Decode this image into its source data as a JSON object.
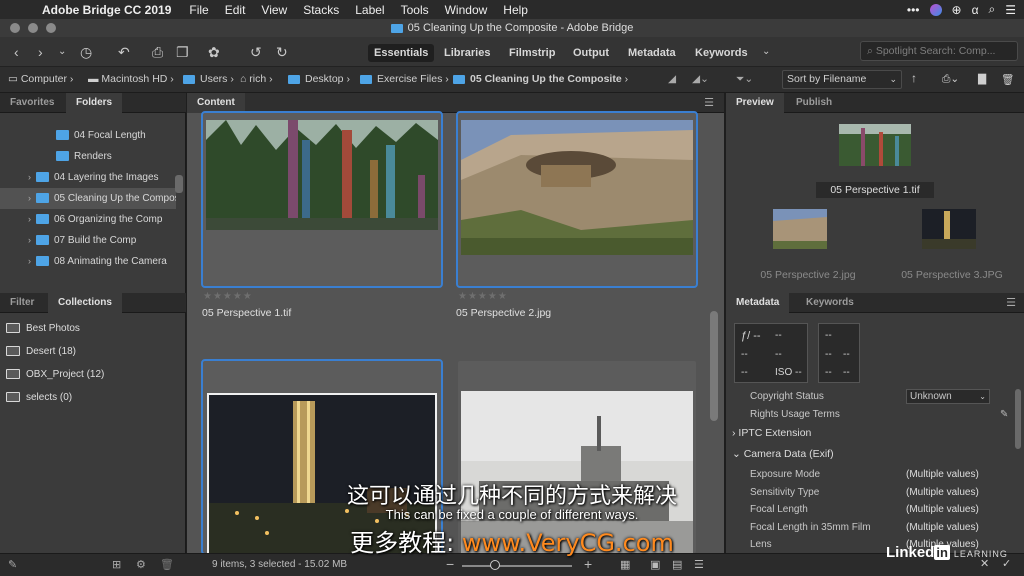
{
  "menubar": {
    "app": "Adobe Bridge CC 2019",
    "items": [
      "File",
      "Edit",
      "View",
      "Stacks",
      "Label",
      "Tools",
      "Window",
      "Help"
    ]
  },
  "window": {
    "title": "05 Cleaning Up the Composite - Adobe Bridge"
  },
  "workspaces": [
    "Essentials",
    "Libraries",
    "Filmstrip",
    "Output",
    "Metadata",
    "Keywords"
  ],
  "search": {
    "placeholder": "Spotlight Search: Comp..."
  },
  "path": [
    "Computer",
    "Macintosh HD",
    "Users",
    "rich",
    "Desktop",
    "Exercise Files",
    "05 Cleaning Up the Composite"
  ],
  "sort": {
    "label": "Sort by Filename"
  },
  "left": {
    "tabs": [
      "Favorites",
      "Folders"
    ],
    "folders": [
      {
        "label": "04 Focal Length",
        "expandable": false,
        "indent": 2,
        "selected": false
      },
      {
        "label": "Renders",
        "expandable": false,
        "indent": 2,
        "selected": false
      },
      {
        "label": "04 Layering the Images",
        "expandable": true,
        "indent": 1,
        "selected": false
      },
      {
        "label": "05 Cleaning Up the Composite",
        "expandable": true,
        "indent": 1,
        "selected": true
      },
      {
        "label": "06 Organizing the Comp",
        "expandable": true,
        "indent": 1,
        "selected": false
      },
      {
        "label": "07 Build the Comp",
        "expandable": true,
        "indent": 1,
        "selected": false
      },
      {
        "label": "08 Animating the Camera",
        "expandable": true,
        "indent": 1,
        "selected": false
      }
    ],
    "lower_tabs": [
      "Filter",
      "Collections"
    ],
    "collections": [
      {
        "label": "Best Photos"
      },
      {
        "label": "Desert (18)"
      },
      {
        "label": "OBX_Project (12)"
      },
      {
        "label": "selects (0)"
      }
    ]
  },
  "content": {
    "tab": "Content",
    "items": [
      {
        "name": "05 Perspective 1.tif",
        "selected": true
      },
      {
        "name": "05 Perspective 2.jpg",
        "selected": true
      },
      {
        "name": "",
        "selected": true
      },
      {
        "name": "",
        "selected": false
      }
    ],
    "status": "9 items, 3 selected - 15.02 MB"
  },
  "right": {
    "tabs": [
      "Preview",
      "Publish"
    ],
    "preview_main": "05 Perspective 1.tif",
    "preview_others": [
      "05 Perspective 2.jpg",
      "05 Perspective 3.JPG"
    ],
    "meta_tabs": [
      "Metadata",
      "Keywords"
    ],
    "exif_box": {
      "f": "ƒ/ --",
      "b": "--",
      "c": "--",
      "d": "--",
      "e": "--",
      "iso": "ISO --",
      "g": "--",
      "h": "--",
      "i": "--",
      "j": "--",
      "k": "--"
    },
    "rows": [
      {
        "label": "Copyright Status",
        "value": "Unknown"
      },
      {
        "label": "Rights Usage Terms",
        "value": ""
      }
    ],
    "sections": [
      "IPTC Extension",
      "Camera Data (Exif)"
    ],
    "exif_rows": [
      {
        "label": "Exposure Mode",
        "value": "(Multiple values)"
      },
      {
        "label": "Sensitivity Type",
        "value": "(Multiple values)"
      },
      {
        "label": "Focal Length",
        "value": "(Multiple values)"
      },
      {
        "label": "Focal Length in 35mm Film",
        "value": "(Multiple values)"
      },
      {
        "label": "Lens",
        "value": "(Multiple values)"
      }
    ]
  },
  "subtitles": {
    "chinese": "这可以通过几种不同的方式来解决",
    "english": "This can be fixed a couple of different ways.",
    "watermark_prefix": "更多教程: ",
    "watermark_url": "www.VeryCG.com"
  },
  "branding": {
    "linkedin": "Linked",
    "in": "in",
    "learning": "LEARNING"
  }
}
